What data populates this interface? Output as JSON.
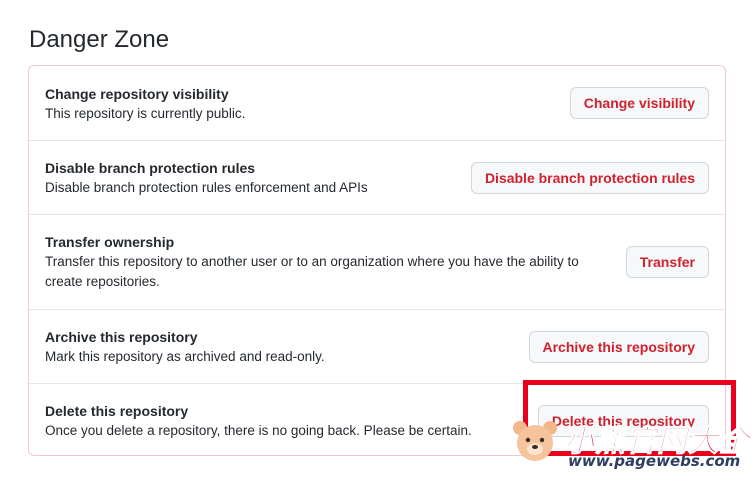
{
  "danger_zone": {
    "title": "Danger Zone",
    "rows": [
      {
        "title": "Change repository visibility",
        "description": "This repository is currently public.",
        "button_label": "Change visibility"
      },
      {
        "title": "Disable branch protection rules",
        "description": "Disable branch protection rules enforcement and APIs",
        "button_label": "Disable branch protection rules"
      },
      {
        "title": "Transfer ownership",
        "description": "Transfer this repository to another user or to an organization where you have the ability to create repositories.",
        "button_label": "Transfer"
      },
      {
        "title": "Archive this repository",
        "description": "Mark this repository as archived and read-only.",
        "button_label": "Archive this repository"
      },
      {
        "title": "Delete this repository",
        "description": "Once you delete a repository, there is no going back. Please be certain.",
        "button_label": "Delete this repository"
      }
    ]
  },
  "watermark": {
    "title": "小熊官网大全",
    "url": "www.pagewebs.com"
  },
  "colors": {
    "danger_text": "#cf222e",
    "danger_border": "#f0c9cc",
    "highlight": "#e8001c"
  }
}
